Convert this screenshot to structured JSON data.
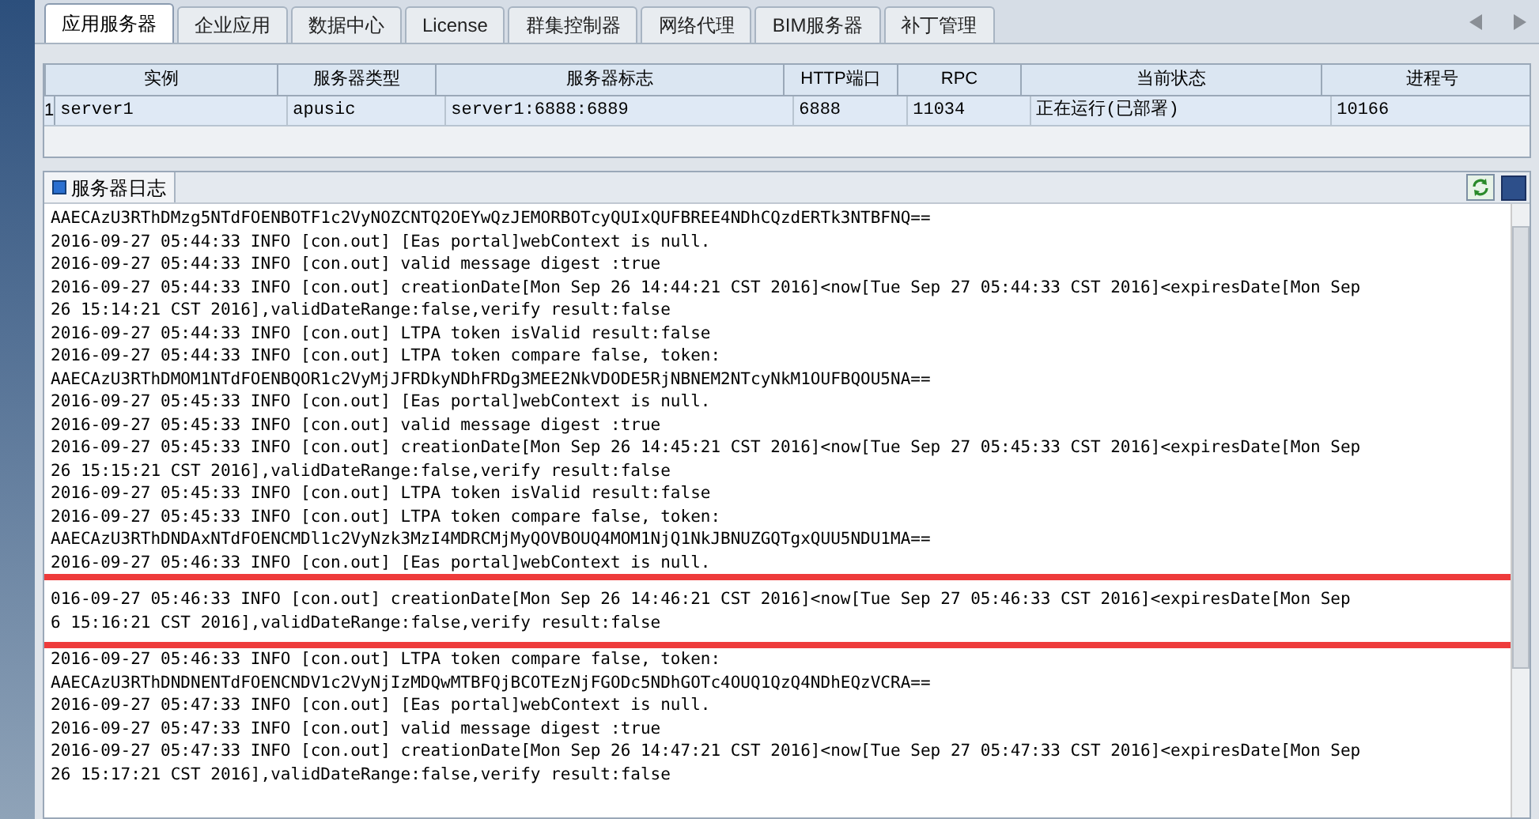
{
  "tabs": [
    {
      "label": "应用服务器",
      "selected": true
    },
    {
      "label": "企业应用",
      "selected": false
    },
    {
      "label": "数据中心",
      "selected": false
    },
    {
      "label": "License",
      "selected": false
    },
    {
      "label": "群集控制器",
      "selected": false
    },
    {
      "label": "网络代理",
      "selected": false
    },
    {
      "label": "BIM服务器",
      "selected": false
    },
    {
      "label": "补丁管理",
      "selected": false
    }
  ],
  "table": {
    "columns": [
      "实例",
      "服务器类型",
      "服务器标志",
      "HTTP端口",
      "RPC",
      "当前状态",
      "进程号"
    ],
    "rows": [
      {
        "index": "1",
        "cells": [
          "server1",
          "apusic",
          "server1:6888:6889",
          "6888",
          "11034",
          "正在运行(已部署)",
          "10166"
        ]
      }
    ]
  },
  "log": {
    "title": "服务器日志",
    "entries": [
      {
        "kind": "line",
        "text": "AAECAzU3RThDMzg5NTdFOENBOTF1c2VyNOZCNTQ2OEYwQzJEMORBOTcyQUIxQUFBREE4NDhCQzdERTk3NTBFNQ=="
      },
      {
        "kind": "line",
        "text": "2016-09-27 05:44:33 INFO [con.out] [Eas portal]webContext is null."
      },
      {
        "kind": "line",
        "text": "2016-09-27 05:44:33 INFO [con.out] valid message digest :true"
      },
      {
        "kind": "line",
        "text": "2016-09-27 05:44:33 INFO [con.out] creationDate[Mon Sep 26 14:44:21 CST 2016]<now[Tue Sep 27 05:44:33 CST 2016]<expiresDate[Mon Sep"
      },
      {
        "kind": "line",
        "text": "26 15:14:21 CST 2016],validDateRange:false,verify result:false"
      },
      {
        "kind": "line",
        "text": "2016-09-27 05:44:33 INFO [con.out] LTPA token isValid result:false"
      },
      {
        "kind": "line",
        "text": "2016-09-27 05:44:33 INFO [con.out] LTPA token compare false, token:"
      },
      {
        "kind": "line",
        "text": "AAECAzU3RThDMOM1NTdFOENBQOR1c2VyMjJFRDkyNDhFRDg3MEE2NkVDODE5RjNBNEM2NTcyNkM1OUFBQOU5NA=="
      },
      {
        "kind": "line",
        "text": "2016-09-27 05:45:33 INFO [con.out] [Eas portal]webContext is null."
      },
      {
        "kind": "line",
        "text": "2016-09-27 05:45:33 INFO [con.out] valid message digest :true"
      },
      {
        "kind": "line",
        "text": "2016-09-27 05:45:33 INFO [con.out] creationDate[Mon Sep 26 14:45:21 CST 2016]<now[Tue Sep 27 05:45:33 CST 2016]<expiresDate[Mon Sep"
      },
      {
        "kind": "line",
        "text": "26 15:15:21 CST 2016],validDateRange:false,verify result:false"
      },
      {
        "kind": "line",
        "text": "2016-09-27 05:45:33 INFO [con.out] LTPA token isValid result:false"
      },
      {
        "kind": "line",
        "text": "2016-09-27 05:45:33 INFO [con.out] LTPA token compare false, token:"
      },
      {
        "kind": "line",
        "text": "AAECAzU3RThDNDAxNTdFOENCMDl1c2VyNzk3MzI4MDRCMjMyQOVBOUQ4MOM1NjQ1NkJBNUZGQTgxQUU5NDU1MA=="
      },
      {
        "kind": "line",
        "text": "2016-09-27 05:46:33 INFO [con.out] [Eas portal]webContext is null."
      },
      {
        "kind": "highlight",
        "lines": [
          "016-09-27 05:46:33 INFO [con.out] creationDate[Mon Sep 26 14:46:21 CST 2016]<now[Tue Sep 27 05:46:33 CST 2016]<expiresDate[Mon Sep",
          "6 15:16:21 CST 2016],validDateRange:false,verify result:false"
        ]
      },
      {
        "kind": "line",
        "text": "2016-09-27 05:46:33 INFO [con.out] LTPA token compare false, token:"
      },
      {
        "kind": "line",
        "text": "AAECAzU3RThDNDNENTdFOENCNDV1c2VyNjIzMDQwMTBFQjBCOTEzNjFGODc5NDhGOTc4OUQ1QzQ4NDhEQzVCRA=="
      },
      {
        "kind": "line",
        "text": "2016-09-27 05:47:33 INFO [con.out] [Eas portal]webContext is null."
      },
      {
        "kind": "line",
        "text": "2016-09-27 05:47:33 INFO [con.out] valid message digest :true"
      },
      {
        "kind": "line",
        "text": "2016-09-27 05:47:33 INFO [con.out] creationDate[Mon Sep 26 14:47:21 CST 2016]<now[Tue Sep 27 05:47:33 CST 2016]<expiresDate[Mon Sep"
      },
      {
        "kind": "line",
        "text": "26 15:17:21 CST 2016],validDateRange:false,verify result:false"
      }
    ]
  }
}
